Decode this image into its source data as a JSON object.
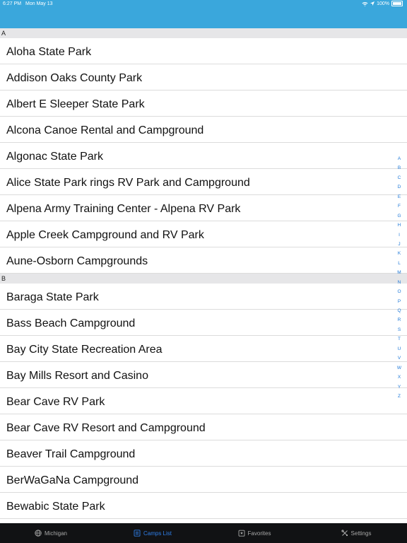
{
  "status": {
    "time": "6:27 PM",
    "date": "Mon May 13",
    "battery": "100%"
  },
  "sections": [
    {
      "letter": "A",
      "items": [
        "Aloha State Park",
        "Addison Oaks County Park",
        "Albert E Sleeper State Park",
        "Alcona Canoe Rental and Campground",
        "Algonac State Park",
        "Alice State Park rings RV Park and Campground",
        "Alpena Army Training Center - Alpena RV Park",
        "Apple Creek Campground and RV Park",
        "Aune-Osborn Campgrounds"
      ]
    },
    {
      "letter": "B",
      "items": [
        "Baraga State Park",
        "Bass Beach Campground",
        "Bay City State Recreation Area",
        "Bay Mills Resort and Casino",
        "Bear Cave RV Park",
        "Bear Cave RV Resort and Campground",
        "Beaver Trail Campground",
        "BerWaGaNa Campground",
        "Bewabic State Park"
      ]
    }
  ],
  "index_letters": [
    "A",
    "B",
    "C",
    "D",
    "E",
    "F",
    "G",
    "H",
    "I",
    "J",
    "K",
    "L",
    "M",
    "N",
    "O",
    "P",
    "Q",
    "R",
    "S",
    "T",
    "U",
    "V",
    "W",
    "X",
    "Y",
    "Z"
  ],
  "tabs": [
    {
      "label": "Michigan",
      "icon": "globe-icon",
      "active": false
    },
    {
      "label": "Camps List",
      "icon": "list-icon",
      "active": true
    },
    {
      "label": "Favorites",
      "icon": "favorites-icon",
      "active": false
    },
    {
      "label": "Settings",
      "icon": "settings-icon",
      "active": false
    }
  ],
  "colors": {
    "header": "#3aa7dc",
    "accent": "#2f7fe8",
    "tabbar": "#111214",
    "section": "#e6e6e8"
  }
}
